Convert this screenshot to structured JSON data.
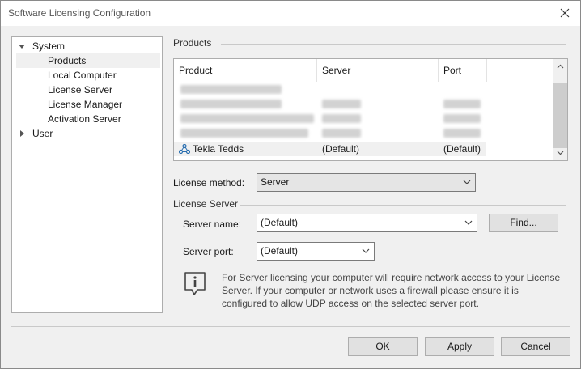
{
  "window": {
    "title": "Software Licensing Configuration",
    "icons": {
      "close": "close-icon"
    }
  },
  "tree": {
    "items": [
      {
        "label": "System",
        "expanded": true,
        "depth": 0
      },
      {
        "label": "Products",
        "selected": true,
        "depth": 1
      },
      {
        "label": "Local Computer",
        "depth": 1
      },
      {
        "label": "License Server",
        "depth": 1
      },
      {
        "label": "License Manager",
        "depth": 1
      },
      {
        "label": "Activation Server",
        "depth": 1
      },
      {
        "label": "User",
        "expanded": false,
        "depth": 0
      }
    ]
  },
  "products": {
    "section_label": "Products",
    "columns": [
      "Product",
      "Server",
      "Port"
    ],
    "visible_row": {
      "product": "Tekla Tedds",
      "server": "(Default)",
      "port": "(Default)",
      "icon": "product-tree-icon"
    }
  },
  "license_method": {
    "label": "License method:",
    "value": "Server"
  },
  "license_server": {
    "section_label": "License Server",
    "server_name_label": "Server name:",
    "server_name_value": "(Default)",
    "find_button": "Find...",
    "server_port_label": "Server port:",
    "server_port_value": "(Default)"
  },
  "info": {
    "icon": "info-icon",
    "lines": [
      "For Server licensing your computer will require network access to your License",
      "Server. If your computer or network uses a firewall please ensure it is",
      "configured to allow UDP access on the selected server port."
    ]
  },
  "buttons": {
    "ok": "OK",
    "apply": "Apply",
    "cancel": "Cancel"
  }
}
